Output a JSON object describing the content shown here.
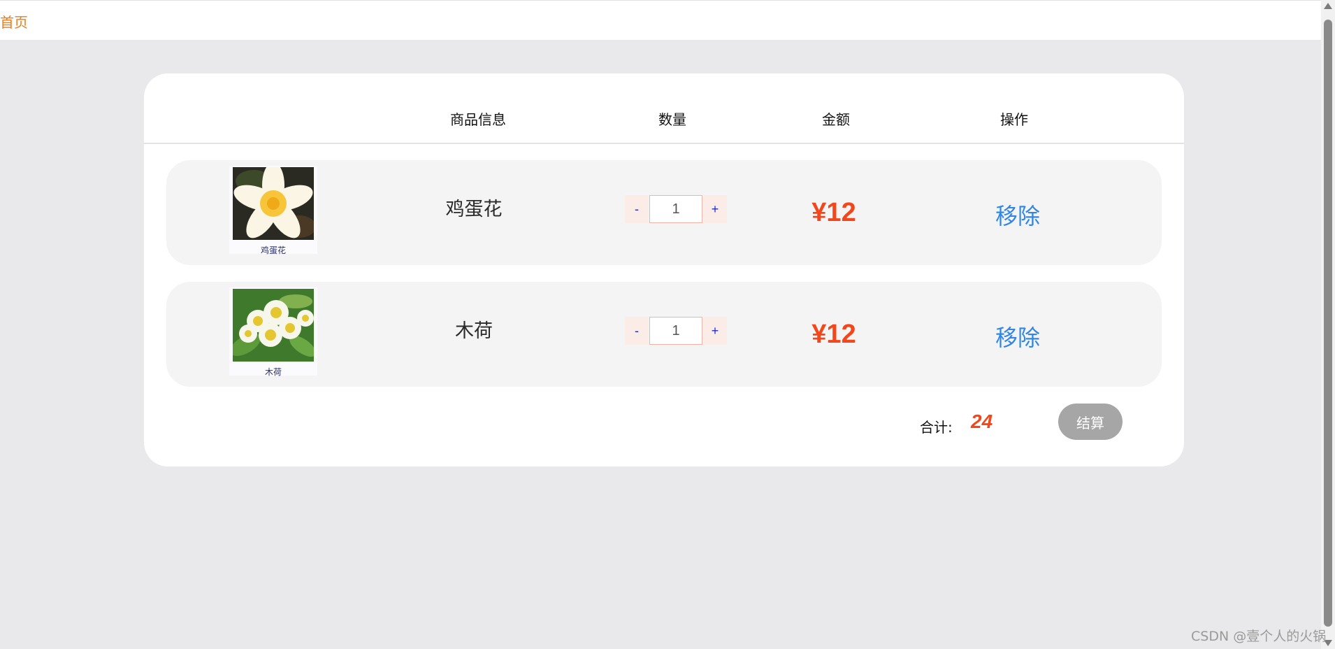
{
  "nav": {
    "home_label": "首页"
  },
  "table": {
    "headers": [
      "商品信息",
      "数量",
      "金额",
      "操作"
    ]
  },
  "items": [
    {
      "name": "鸡蛋花",
      "image_caption": "鸡蛋花",
      "image_icon": "frangipani-flower-photo",
      "quantity": "1",
      "price": "¥12",
      "remove_label": "移除",
      "minus_label": "-",
      "plus_label": "+"
    },
    {
      "name": "木荷",
      "image_caption": "木荷",
      "image_icon": "schima-flower-photo",
      "quantity": "1",
      "price": "¥12",
      "remove_label": "移除",
      "minus_label": "-",
      "plus_label": "+"
    }
  ],
  "summary": {
    "total_label": "合计:",
    "total_value": "24",
    "checkout_label": "结算"
  },
  "watermark": "CSDN @壹个人的火锅",
  "colors": {
    "accent_orange": "#f07c1a",
    "price_red": "#f2471a",
    "link_blue": "#2f86e8",
    "checkout_gray": "#a6a6a6",
    "background": "#e9e8ea"
  }
}
